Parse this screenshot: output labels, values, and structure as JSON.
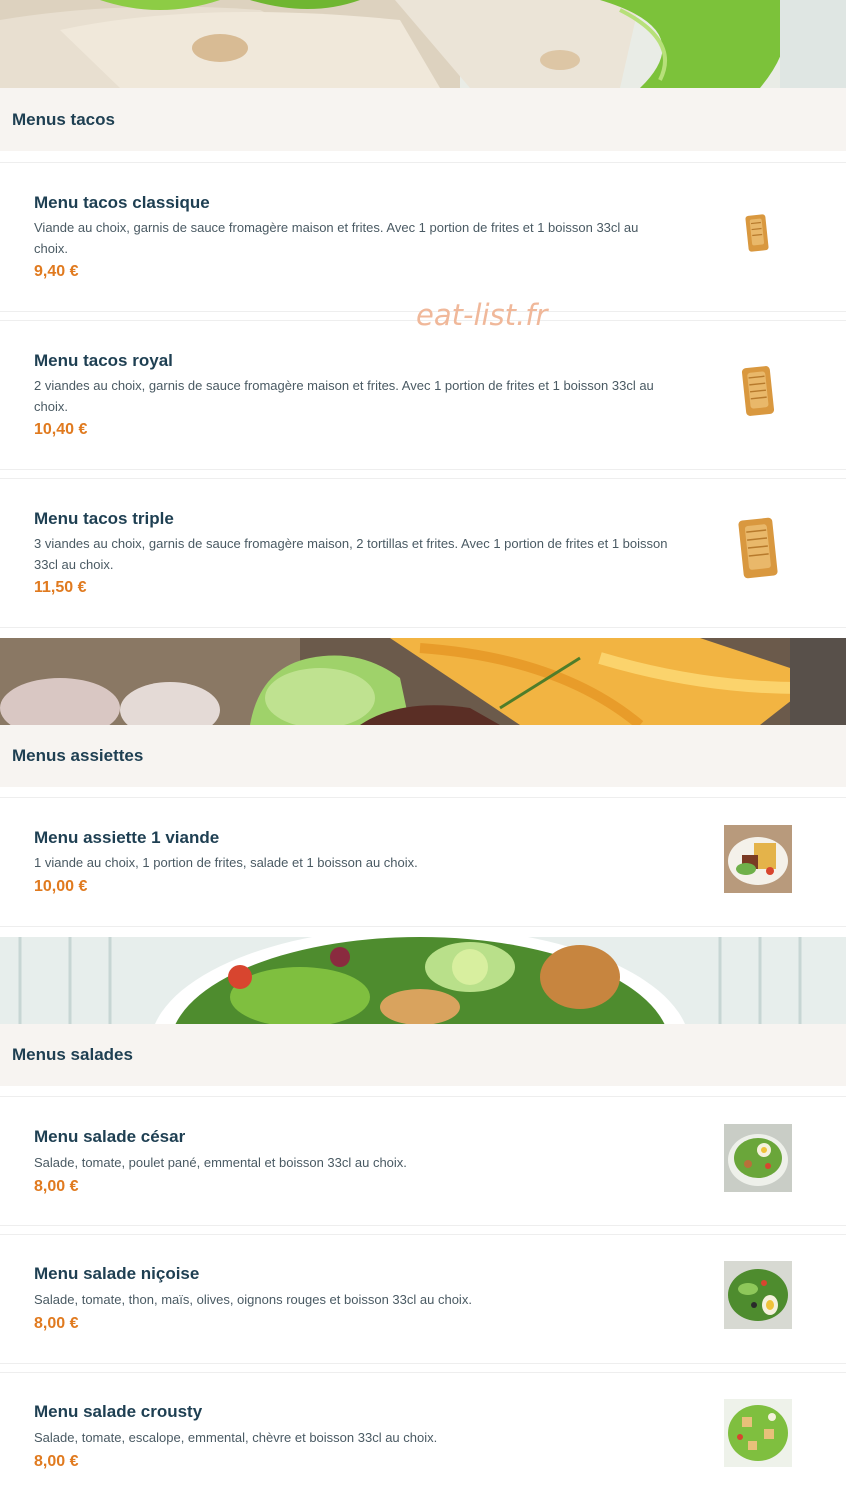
{
  "watermark": "eat-list.fr",
  "sections": [
    {
      "title": "Menus tacos",
      "items": [
        {
          "name": "Menu tacos classique",
          "description": "Viande au choix, garnis de sauce fromagère maison et frites. Avec 1 portion de frites et 1 boisson 33cl au choix.",
          "price": "9,40 €",
          "image": "tacos-thumbnail"
        },
        {
          "name": "Menu tacos royal",
          "description": "2 viandes au choix, garnis de sauce fromagère maison et frites. Avec 1 portion de frites et 1 boisson 33cl au choix.",
          "price": "10,40 €",
          "image": "tacos-thumbnail"
        },
        {
          "name": "Menu tacos triple",
          "description": "3 viandes au choix, garnis de sauce fromagère maison, 2 tortillas et frites. Avec 1 portion de frites et 1 boisson 33cl au choix.",
          "price": "11,50 €",
          "image": "tacos-thumbnail"
        }
      ]
    },
    {
      "title": "Menus assiettes",
      "items": [
        {
          "name": "Menu assiette 1 viande",
          "description": "1 viande au choix, 1 portion de frites, salade et 1 boisson au choix.",
          "price": "10,00 €",
          "image": "plate-thumbnail"
        }
      ]
    },
    {
      "title": "Menus salades",
      "items": [
        {
          "name": "Menu salade césar",
          "description": "Salade, tomate, poulet pané, emmental et boisson 33cl au choix.",
          "price": "8,00 €",
          "image": "salad-thumbnail"
        },
        {
          "name": "Menu salade niçoise",
          "description": "Salade, tomate, thon, maïs, olives, oignons rouges et boisson 33cl au choix.",
          "price": "8,00 €",
          "image": "salad-thumbnail"
        },
        {
          "name": "Menu salade crousty",
          "description": "Salade, tomate, escalope, emmental, chèvre et boisson 33cl au choix.",
          "price": "8,00 €",
          "image": "salad-thumbnail"
        }
      ]
    }
  ],
  "colors": {
    "price": "#e07a1f",
    "title": "#1e3f52",
    "header_bg": "#f7f4f1"
  }
}
